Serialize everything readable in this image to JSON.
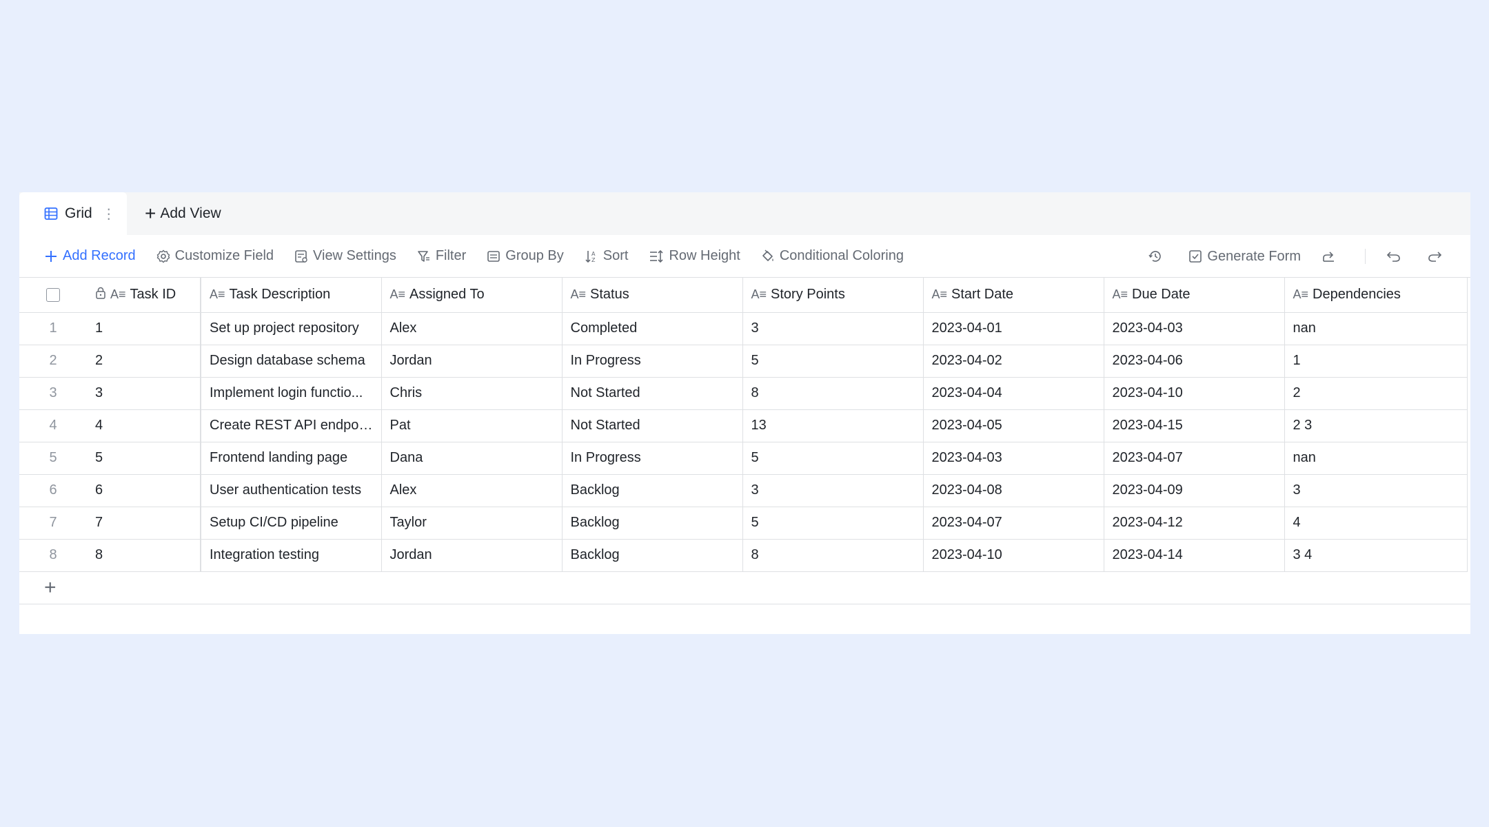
{
  "tabs": {
    "active_label": "Grid",
    "add_view_label": "Add View"
  },
  "toolbar": {
    "add_record": "Add Record",
    "customize_field": "Customize Field",
    "view_settings": "View Settings",
    "filter": "Filter",
    "group_by": "Group By",
    "sort": "Sort",
    "row_height": "Row Height",
    "conditional_coloring": "Conditional Coloring",
    "generate_form": "Generate Form"
  },
  "columns": [
    "Task ID",
    "Task Description",
    "Assigned To",
    "Status",
    "Story Points",
    "Start Date",
    "Due Date",
    "Dependencies"
  ],
  "rows": [
    {
      "num": "1",
      "id": "1",
      "desc": "Set up project repository",
      "assigned": "Alex",
      "status": "Completed",
      "points": "3",
      "start": "2023-04-01",
      "due": "2023-04-03",
      "deps": "nan"
    },
    {
      "num": "2",
      "id": "2",
      "desc": "Design database schema",
      "assigned": "Jordan",
      "status": "In Progress",
      "points": "5",
      "start": "2023-04-02",
      "due": "2023-04-06",
      "deps": "1"
    },
    {
      "num": "3",
      "id": "3",
      "desc": "Implement login functio...",
      "assigned": "Chris",
      "status": "Not Started",
      "points": "8",
      "start": "2023-04-04",
      "due": "2023-04-10",
      "deps": "2"
    },
    {
      "num": "4",
      "id": "4",
      "desc": "Create REST API endpoi...",
      "assigned": "Pat",
      "status": "Not Started",
      "points": "13",
      "start": "2023-04-05",
      "due": "2023-04-15",
      "deps": "2 3"
    },
    {
      "num": "5",
      "id": "5",
      "desc": "Frontend landing page",
      "assigned": "Dana",
      "status": "In Progress",
      "points": "5",
      "start": "2023-04-03",
      "due": "2023-04-07",
      "deps": "nan"
    },
    {
      "num": "6",
      "id": "6",
      "desc": "User authentication tests",
      "assigned": "Alex",
      "status": "Backlog",
      "points": "3",
      "start": "2023-04-08",
      "due": "2023-04-09",
      "deps": "3"
    },
    {
      "num": "7",
      "id": "7",
      "desc": "Setup CI/CD pipeline",
      "assigned": "Taylor",
      "status": "Backlog",
      "points": "5",
      "start": "2023-04-07",
      "due": "2023-04-12",
      "deps": "4"
    },
    {
      "num": "8",
      "id": "8",
      "desc": "Integration testing",
      "assigned": "Jordan",
      "status": "Backlog",
      "points": "8",
      "start": "2023-04-10",
      "due": "2023-04-14",
      "deps": "3 4"
    }
  ],
  "add_row_glyph": "+",
  "colors": {
    "background": "#e8effd",
    "accent": "#3370ff",
    "border": "#dee0e3",
    "muted_text": "#646a73"
  }
}
